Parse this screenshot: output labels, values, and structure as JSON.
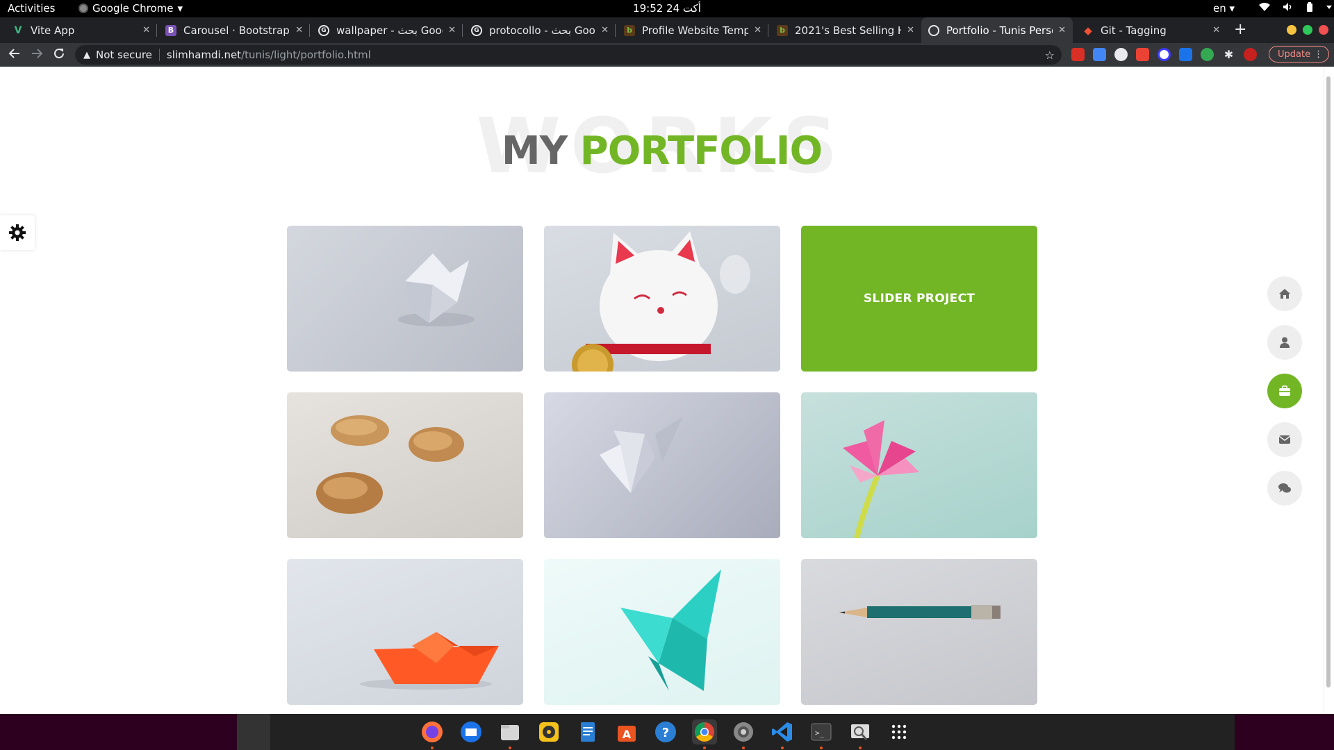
{
  "system_bar": {
    "activities": "Activities",
    "app_name": "Google Chrome",
    "app_caret": "▾",
    "clock": "19:52  24 أكت",
    "lang": "en ▾"
  },
  "tabs": [
    {
      "title": "Vite App",
      "favicon": "vite",
      "color": "#41b883",
      "glyph": "V"
    },
    {
      "title": "Carousel · Bootstrap",
      "favicon": "bootstrap",
      "color": "#7952b3",
      "glyph": "B"
    },
    {
      "title": "wallpaper - بحث Goog",
      "favicon": "google",
      "color": "#e8eaed",
      "glyph": "G"
    },
    {
      "title": "protocollo - بحث Goog",
      "favicon": "google",
      "color": "#e8eaed",
      "glyph": "G"
    },
    {
      "title": "Profile Website Temp",
      "favicon": "themeforest",
      "color": "#81b441",
      "glyph": "b"
    },
    {
      "title": "2021's Best Selling H",
      "favicon": "themeforest",
      "color": "#81b441",
      "glyph": "b"
    },
    {
      "title": "Portfolio - Tunis Perso",
      "favicon": "globe",
      "color": "#e8eaed",
      "glyph": "◎",
      "active": true
    },
    {
      "title": "Git - Tagging",
      "favicon": "git",
      "color": "#f05033",
      "glyph": "◆"
    }
  ],
  "toolbar": {
    "security_label": "Not secure",
    "url_host": "slimhamdi.net",
    "url_path": "/tunis/light/portfolio.html",
    "update_label": "Update"
  },
  "page": {
    "bg_title": "WORKS",
    "title_part1": "MY",
    "title_part2": "PORTFOLIO",
    "accent": "#72b626",
    "portfolio_items": [
      {
        "kind": "origami-cube",
        "caption": ""
      },
      {
        "kind": "lucky-cat",
        "caption": ""
      },
      {
        "kind": "hover-overlay",
        "caption": "SLIDER PROJECT"
      },
      {
        "kind": "fortune-cookies",
        "caption": ""
      },
      {
        "kind": "origami-butterfly-white",
        "caption": ""
      },
      {
        "kind": "origami-flower",
        "caption": ""
      },
      {
        "kind": "paper-boat",
        "caption": ""
      },
      {
        "kind": "origami-butterfly-teal",
        "caption": ""
      },
      {
        "kind": "pencil",
        "caption": ""
      }
    ],
    "side_nav": [
      "home-icon",
      "user-icon",
      "briefcase-icon",
      "envelope-icon",
      "comments-icon"
    ],
    "active_nav": "briefcase-icon"
  },
  "dock": [
    "firefox-icon",
    "thunderbird-icon",
    "files-icon",
    "rhythmbox-icon",
    "writer-icon",
    "software-icon",
    "help-icon",
    "chrome-icon",
    "settings-icon",
    "vscode-icon",
    "terminal-icon",
    "screenshot-icon",
    "app-grid-icon"
  ]
}
